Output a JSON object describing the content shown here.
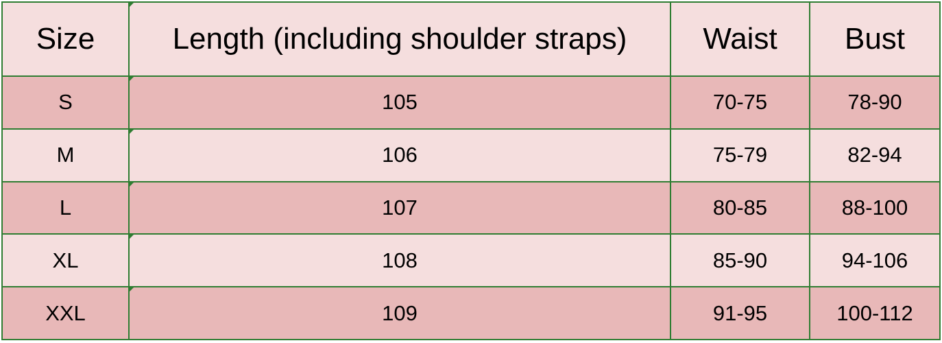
{
  "table": {
    "headers": {
      "size": "Size",
      "length": "Length (including shoulder straps)",
      "waist": "Waist",
      "bust": "Bust"
    },
    "rows": [
      {
        "size": "S",
        "length": "105",
        "waist": "70-75",
        "bust": "78-90"
      },
      {
        "size": "M",
        "length": "106",
        "waist": "75-79",
        "bust": "82-94"
      },
      {
        "size": "L",
        "length": "107",
        "waist": "80-85",
        "bust": "88-100"
      },
      {
        "size": "XL",
        "length": "108",
        "waist": "85-90",
        "bust": "94-106"
      },
      {
        "size": "XXL",
        "length": "109",
        "waist": "91-95",
        "bust": "100-112"
      }
    ]
  },
  "colors": {
    "border": "#2f7d32",
    "row_dark": "#e8b8b8",
    "row_light": "#f5dede",
    "text": "#000000"
  }
}
